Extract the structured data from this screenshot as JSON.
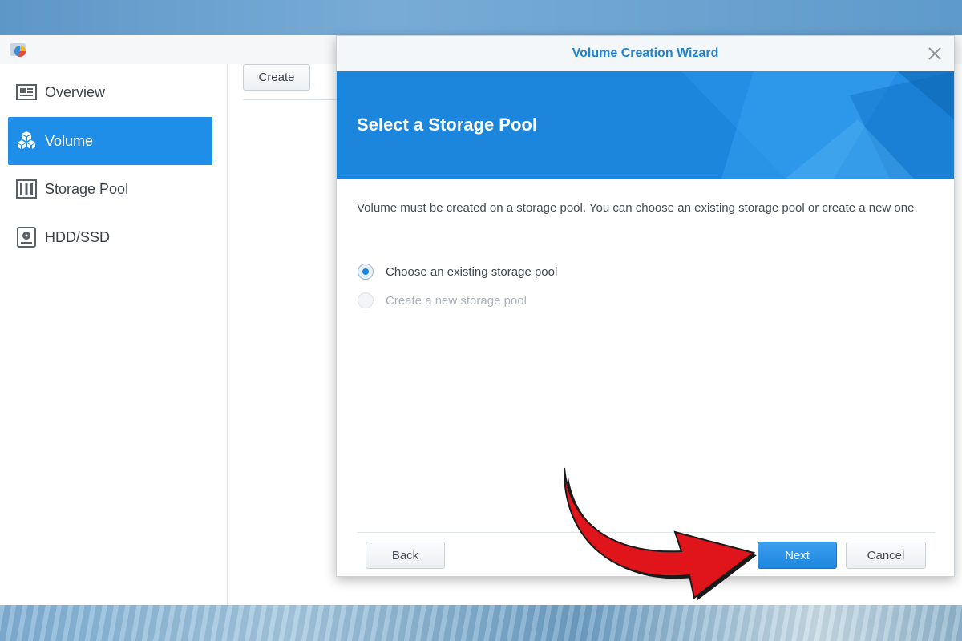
{
  "sidebar": {
    "items": [
      {
        "label": "Overview",
        "icon": "overview-icon",
        "active": false
      },
      {
        "label": "Volume",
        "icon": "cubes-icon",
        "active": true
      },
      {
        "label": "Storage Pool",
        "icon": "storage-pool-icon",
        "active": false
      },
      {
        "label": "HDD/SSD",
        "icon": "hdd-icon",
        "active": false
      }
    ]
  },
  "toolbar": {
    "create_label": "Create"
  },
  "wizard": {
    "title": "Volume Creation Wizard",
    "banner_title": "Select a Storage Pool",
    "description": "Volume must be created on a storage pool. You can choose an existing storage pool or create a new one.",
    "options": [
      {
        "label": "Choose an existing storage pool",
        "selected": true,
        "enabled": true
      },
      {
        "label": "Create a new storage pool",
        "selected": false,
        "enabled": false
      }
    ],
    "buttons": {
      "back": "Back",
      "next": "Next",
      "cancel": "Cancel"
    }
  },
  "colors": {
    "accent": "#1e8ee8",
    "banner": "#1c86dd",
    "annotation_arrow": "#e0141b"
  }
}
